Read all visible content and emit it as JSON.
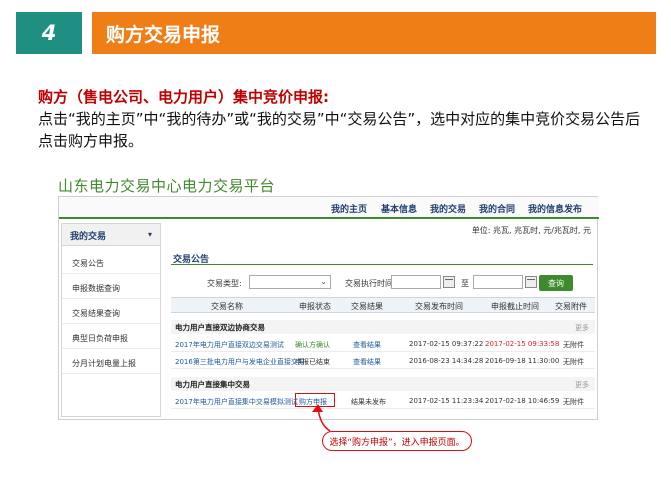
{
  "slide": {
    "section_number": "4",
    "section_title": "购方交易申报",
    "lead_heading": "购方（售电公司、电力用户）集中竞价申报:",
    "lead_body": "点击“我的主页”中“我的待办”或“我的交易”中“交易公告”，选中对应的集中竞价交易公告后点击购方申报。"
  },
  "platform_title": "山东电力交易中心电力交易平台",
  "topnav": [
    "我的主页",
    "基本信息",
    "我的交易",
    "我的合同",
    "我的信息发布"
  ],
  "unit_text": "单位: 兆瓦, 兆瓦时, 元/兆瓦时, 元",
  "sidebar": {
    "heading": "我的交易",
    "caret": "▾",
    "items": [
      "交易公告",
      "申报数据查询",
      "交易结果查询",
      "典型日负荷申报",
      "分月计划电量上报"
    ]
  },
  "notice": {
    "title": "交易公告",
    "filters": {
      "type_label": "交易类型:",
      "type_value": "",
      "time_label": "交易执行时间:",
      "to_label": "至",
      "search_label": "查询"
    }
  },
  "table": {
    "headers": [
      "交易名称",
      "申报状态",
      "交易结果",
      "交易发布时间",
      "申报截止时间",
      "交易附件"
    ],
    "groups": [
      {
        "title": "电力用户直接双边协商交易",
        "more": "更多",
        "rows": [
          [
            "2017年电力用户直接双边交易测试",
            "确认方确认",
            "查看结果",
            "2017-02-15 09:37:22",
            "2017-02-15 09:33:58",
            "无附件"
          ],
          [
            "2016第三批电力用户与发电企业直接交易",
            "申报已结束",
            "查看结果",
            "2016-08-23 14:34:28",
            "2016-09-18 11:30:00",
            "无附件"
          ]
        ]
      },
      {
        "title": "电力用户直接集中交易",
        "more": "更多",
        "rows": [
          [
            "2017年电力用户直接集中交易模拟测试",
            "购方申报",
            "结果未发布",
            "2017-02-15 11:23:34",
            "2017-02-18 10:46:59",
            "无附件"
          ]
        ]
      }
    ]
  },
  "callout_text": "选择“购方申报”，进入申报页面。",
  "colors": {
    "teal": "#1e8f80",
    "orange": "#f07e17",
    "red_text": "#c00000",
    "green": "#3f8a2c",
    "link_blue": "#1f5aa0"
  }
}
